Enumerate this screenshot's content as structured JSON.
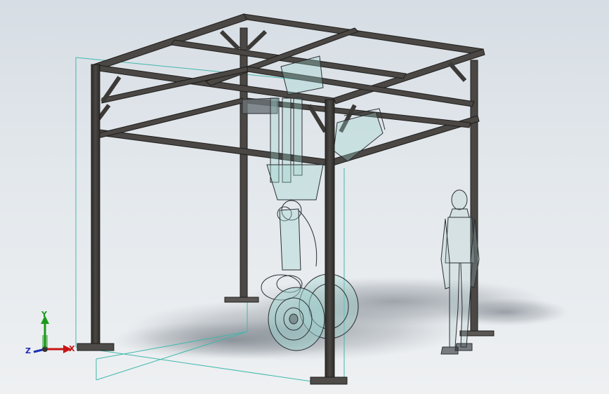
{
  "viewport": {
    "background": "#dde3e8",
    "bounding_box_color": "#3fb8ad",
    "frame_color": "#3c3a37",
    "model_line_color": "#2a2f33",
    "model_fill_color": "#9fd3cf"
  },
  "triad": {
    "y_label": "Y",
    "x_label": "X",
    "z_label": "Z",
    "y_color": "#1a9a1a",
    "x_color": "#c81414",
    "z_color": "#1b2fb5"
  }
}
